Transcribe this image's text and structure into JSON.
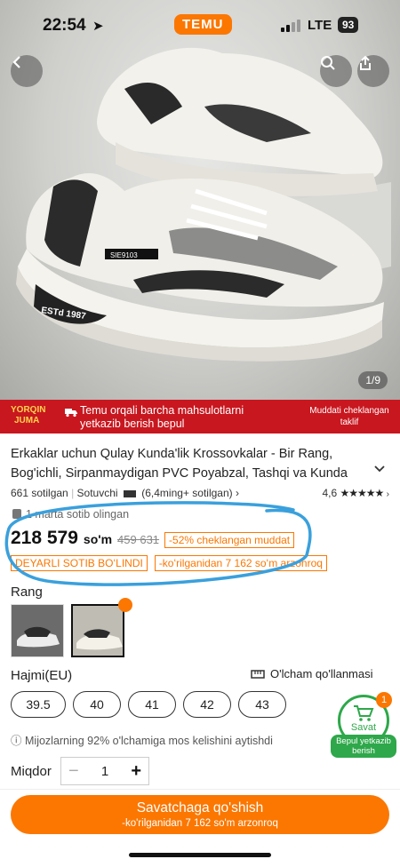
{
  "status_bar": {
    "time": "22:54",
    "app_badge": "TEMU",
    "network": "LTE",
    "battery": "93"
  },
  "gallery": {
    "counter": "1/9",
    "shoe_lettering": [
      "ESTd 1987",
      "SIE9103"
    ]
  },
  "promo": {
    "brand_line1": "YORQIN",
    "brand_line2": "JUMA",
    "message": "Temu orqali barcha mahsulotlarni yetkazib berish bepul",
    "timer_text": "Muddati cheklangan taklif"
  },
  "product": {
    "title": "Erkaklar uchun Qulay Kunda'lik Krossovkalar - Bir Rang, Bog'ichli, Sirpanmaydigan PVC Poyabzal, Tashqi va Kunda",
    "sold": "661 sotilgan",
    "seller": "Sotuvchi",
    "seller_sales": "(6,4ming+ sotilgan)",
    "rating": "4,6",
    "stars": "★★★★★",
    "bought_note": "1 marta sotib olingan",
    "price": "218 579",
    "currency": "so'm",
    "old_price": "459 631",
    "discount": "-52% cheklangan muddat",
    "tag_selling": "DEYARLI SOTIB BOʻLINDI",
    "tag_savings": "-koʻrilganidan 7 162 soʻm arzonroq"
  },
  "color": {
    "label": "Rang"
  },
  "size": {
    "label": "Hajmi(EU)",
    "guide": "O'lcham qo'llanmasi",
    "options": [
      "39.5",
      "40",
      "41",
      "42",
      "43"
    ],
    "fit_note": "Mijozlarning 92% o'lchamiga mos kelishini aytishdi"
  },
  "quantity": {
    "label": "Miqdor",
    "value": "1"
  },
  "cart": {
    "label": "Savat",
    "count": "1",
    "free_shipping": "Bepul yetkazib berish"
  },
  "cta": {
    "label": "Savatchaga qo'shish",
    "sub": "-ko'rilganidan 7 162 so'm arzonroq"
  },
  "colors": {
    "accent": "#fb7701",
    "promo_red": "#c8171f",
    "green": "#2ea84a",
    "annotation_blue": "#3aa0dc"
  }
}
